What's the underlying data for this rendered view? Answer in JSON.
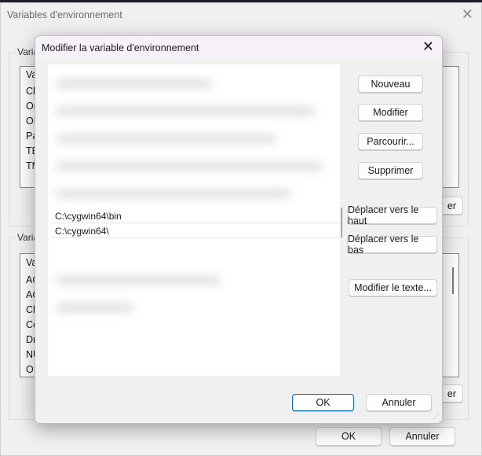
{
  "outer_window": {
    "title": "Variables d'environnement",
    "close_icon": "close-icon",
    "user_group": {
      "label": "Varia",
      "items": [
        "Va",
        "Ch",
        "Or",
        "OF",
        "Pa",
        "TE",
        "TM"
      ],
      "button_partial": "er"
    },
    "system_group": {
      "label": "Varia",
      "items": [
        "Va",
        "AC",
        "AC",
        "Ch",
        "Co",
        "Dr",
        "NU",
        "OS"
      ],
      "button_partial": "er"
    },
    "ok": "OK",
    "cancel": "Annuler"
  },
  "dialog": {
    "title": "Modifier la variable d'environnement",
    "close_icon": "close-icon",
    "entries": [
      "C:\\cygwin64\\bin",
      "C:\\cygwin64\\"
    ],
    "buttons": {
      "new": "Nouveau",
      "edit": "Modifier",
      "browse": "Parcourir...",
      "delete": "Supprimer",
      "move_up": "Déplacer vers le haut",
      "move_down": "Déplacer vers le bas",
      "edit_text": "Modifier le texte..."
    },
    "ok": "OK",
    "cancel": "Annuler",
    "accent": "#0067c0"
  }
}
